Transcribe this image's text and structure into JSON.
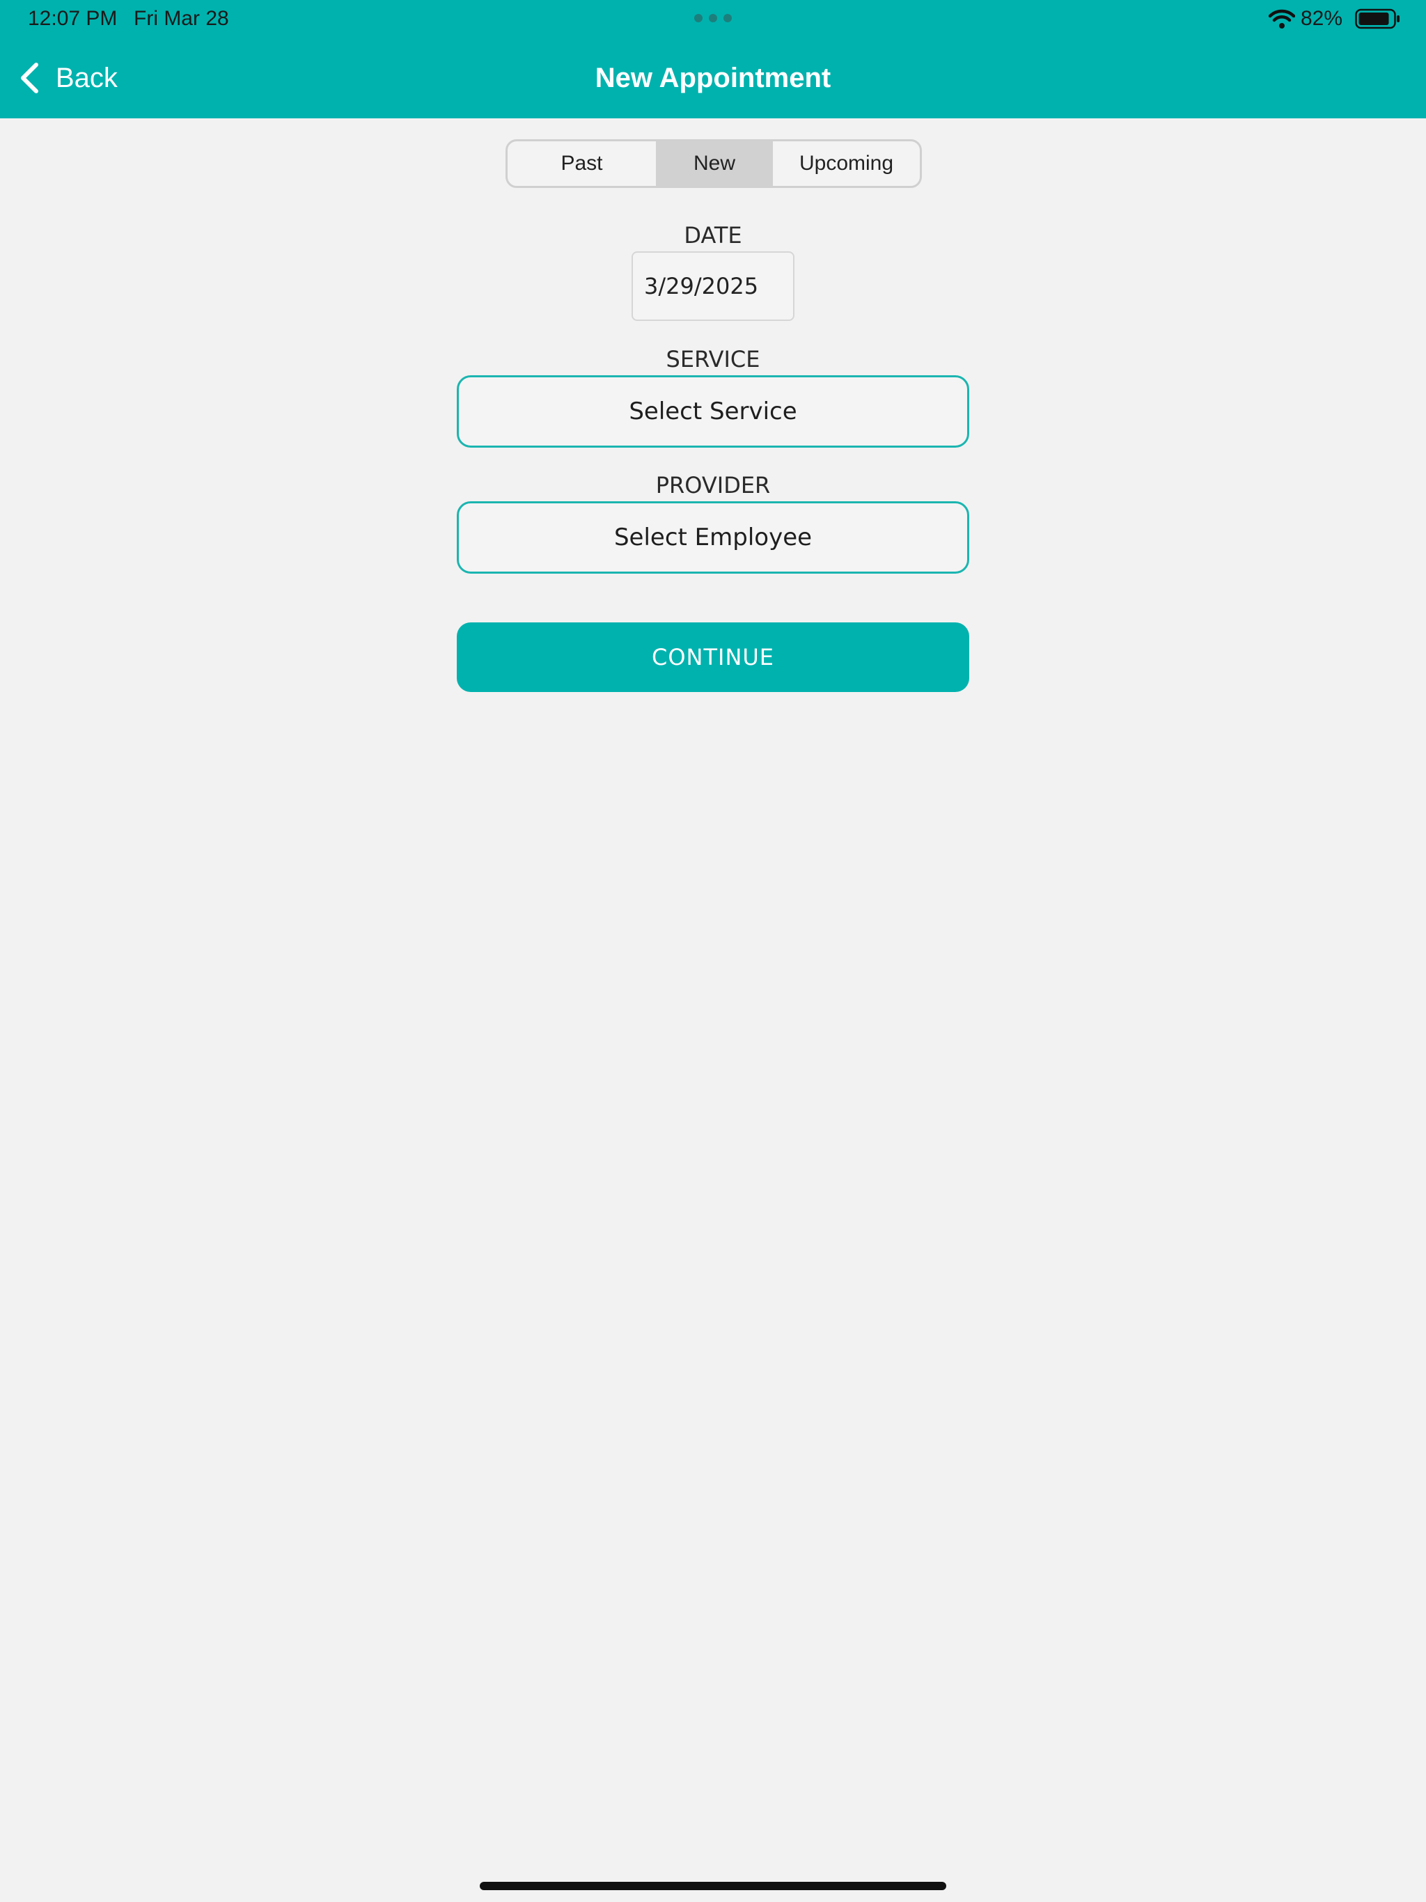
{
  "status_bar": {
    "time": "12:07 PM",
    "date": "Fri Mar 28",
    "battery": "82%"
  },
  "nav": {
    "back_label": "Back",
    "title": "New Appointment"
  },
  "segments": {
    "past": "Past",
    "new": "New",
    "upcoming": "Upcoming",
    "selected": "New"
  },
  "form": {
    "date_label": "DATE",
    "date_value": "3/29/2025",
    "service_label": "SERVICE",
    "service_value": "Select Service",
    "provider_label": "PROVIDER",
    "provider_value": "Select Employee"
  },
  "actions": {
    "continue_label": "CONTINUE"
  },
  "colors": {
    "accent": "#00b2ae",
    "background": "#f2f2f2"
  }
}
